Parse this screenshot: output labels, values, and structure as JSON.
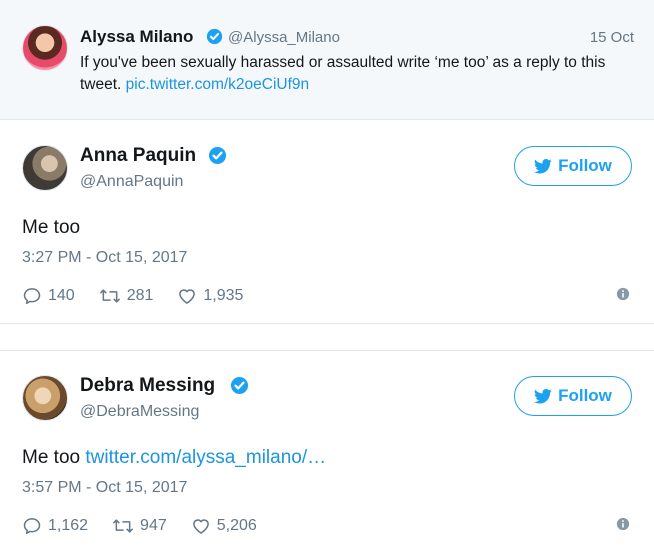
{
  "quoted_tweet": {
    "name": "Alyssa Milano",
    "handle": "@Alyssa_Milano",
    "date": "15 Oct",
    "text": "If you've been sexually harassed or assaulted write ‘me too’ as a reply to this tweet.",
    "link": "pic.twitter.com/k2oeCiUf9n"
  },
  "tweets": [
    {
      "name": "Anna Paquin",
      "handle": "@AnnaPaquin",
      "follow_label": "Follow",
      "text": "Me too",
      "link": "",
      "time": "3:27 PM - Oct 15, 2017",
      "replies": "140",
      "retweets": "281",
      "likes": "1,935"
    },
    {
      "name": "Debra Messing",
      "handle": "@DebraMessing",
      "follow_label": "Follow",
      "text": "Me too",
      "link": "twitter.com/alyssa_milano/…",
      "time": "3:57 PM - Oct 15, 2017",
      "replies": "1,162",
      "retweets": "947",
      "likes": "5,206"
    }
  ],
  "colors": {
    "brand_blue": "#1da1f2",
    "link_blue": "#1b95e0",
    "muted_gray": "#657786",
    "quoted_bg": "#f5f8fa"
  },
  "icons": [
    "verified-badge-icon",
    "twitter-bird-icon",
    "reply-icon",
    "retweet-icon",
    "like-icon",
    "info-icon"
  ]
}
